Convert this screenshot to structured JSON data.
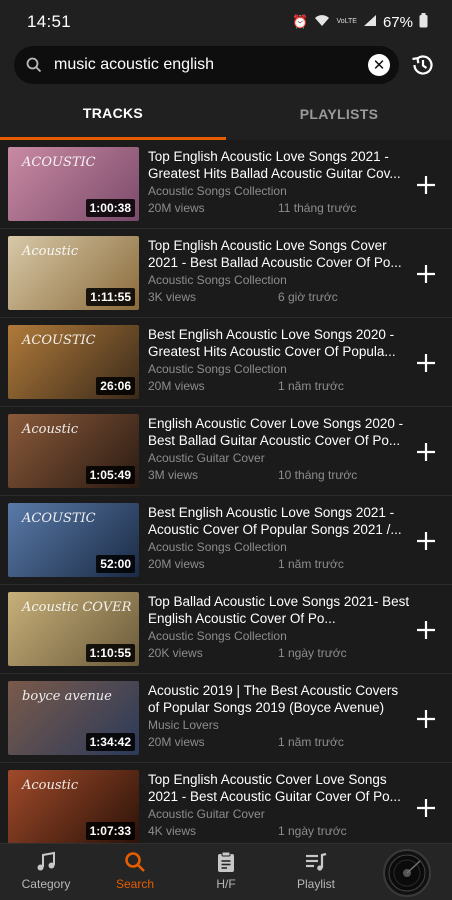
{
  "status": {
    "time": "14:51",
    "battery": "67%",
    "network": "VoLTE"
  },
  "search": {
    "query": "music acoustic english"
  },
  "tabs": [
    {
      "label": "TRACKS",
      "active": true
    },
    {
      "label": "PLAYLISTS",
      "active": false
    }
  ],
  "tracks": [
    {
      "title": "Top English Acoustic Love Songs 2021 - Greatest Hits Ballad Acoustic Guitar Cov...",
      "channel": "Acoustic Songs Collection",
      "views": "20M views",
      "ago": "11 tháng trước",
      "duration": "1:00:38",
      "thumb_text": "ACOUSTIC",
      "thumb_colors": [
        "#c98aa3",
        "#7a4a6a"
      ]
    },
    {
      "title": "Top English Acoustic Love Songs Cover 2021 - Best Ballad Acoustic Cover Of Po...",
      "channel": "Acoustic Songs Collection",
      "views": "3K views",
      "ago": "6 giờ trước",
      "duration": "1:11:55",
      "thumb_text": "Acoustic",
      "thumb_colors": [
        "#d8c9a8",
        "#8a6a3a"
      ]
    },
    {
      "title": "Best English Acoustic Love Songs 2020 - Greatest Hits Acoustic Cover Of Popula...",
      "channel": "Acoustic Songs Collection",
      "views": "20M views",
      "ago": "1 năm trước",
      "duration": "26:06",
      "thumb_text": "ACOUSTIC",
      "thumb_colors": [
        "#b07a3a",
        "#3a2a1a"
      ]
    },
    {
      "title": "English Acoustic Cover Love Songs 2020 - Best Ballad Guitar Acoustic Cover Of Po...",
      "channel": "Acoustic Guitar Cover",
      "views": "3M views",
      "ago": "10 tháng trước",
      "duration": "1:05:49",
      "thumb_text": "Acoustic",
      "thumb_colors": [
        "#8a5a3a",
        "#2a1a12"
      ]
    },
    {
      "title": "Best English Acoustic Love Songs 2021 - Acoustic Cover Of Popular Songs 2021 /...",
      "channel": "Acoustic Songs Collection",
      "views": "20M views",
      "ago": "1 năm trước",
      "duration": "52:00",
      "thumb_text": "ACOUSTIC",
      "thumb_colors": [
        "#5a7aa8",
        "#1a2a44"
      ]
    },
    {
      "title": "Top Ballad Acoustic Love Songs 2021- Best English Acoustic Cover Of Po...",
      "channel": "Acoustic Songs Collection",
      "views": "20K views",
      "ago": "1 ngày trước",
      "duration": "1:10:55",
      "thumb_text": "Acoustic COVER",
      "thumb_colors": [
        "#c8b07a",
        "#6a5a3a"
      ]
    },
    {
      "title": "Acoustic 2019 | The Best Acoustic Covers of Popular Songs 2019 (Boyce Avenue)",
      "channel": "Music Lovers",
      "views": "20M views",
      "ago": "1 năm trước",
      "duration": "1:34:42",
      "thumb_text": "boyce avenue",
      "thumb_colors": [
        "#7a5a4a",
        "#2a3a5a"
      ]
    },
    {
      "title": "Top English Acoustic Cover Love Songs 2021 - Best Acoustic Guitar Cover Of Po...",
      "channel": "Acoustic Guitar Cover",
      "views": "4K views",
      "ago": "1 ngày trước",
      "duration": "1:07:33",
      "thumb_text": "Acoustic",
      "thumb_colors": [
        "#a04a2a",
        "#2a1208"
      ]
    }
  ],
  "nav": [
    {
      "label": "Category",
      "icon": "music-note-icon",
      "active": false
    },
    {
      "label": "Search",
      "icon": "search-icon",
      "active": true
    },
    {
      "label": "H/F",
      "icon": "clipboard-icon",
      "active": false
    },
    {
      "label": "Playlist",
      "icon": "playlist-icon",
      "active": false
    }
  ],
  "colors": {
    "accent": "#e65c00",
    "background": "#1b1b1b",
    "secondary_text": "#8d8d8d"
  }
}
